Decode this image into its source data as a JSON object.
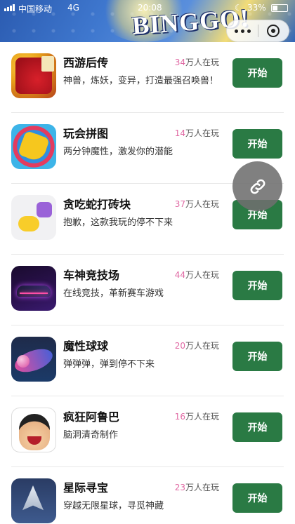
{
  "status_bar": {
    "carrier": "中国移动",
    "network": "4G",
    "time": "20:08",
    "battery_percent": "33%"
  },
  "header": {
    "banner_title": "BINGGO!",
    "menu_icon": "more-dots-icon",
    "close_icon": "target-close-icon"
  },
  "games": [
    {
      "name": "西游后传",
      "players_count": "34",
      "players_suffix": "万人在玩",
      "description": "神兽，炼妖，变异，打造最强召唤兽！",
      "start_label": "开始",
      "icon": "xiyou-game-icon"
    },
    {
      "name": "玩会拼图",
      "players_count": "14",
      "players_suffix": "万人在玩",
      "description": "两分钟魔性，激发你的潜能",
      "start_label": "开始",
      "icon": "jigsaw-game-icon"
    },
    {
      "name": "贪吃蛇打砖块",
      "players_count": "37",
      "players_suffix": "万人在玩",
      "description": "抱歉，这款我玩的停不下来",
      "start_label": "开始",
      "icon": "snake-game-icon"
    },
    {
      "name": "车神竞技场",
      "players_count": "44",
      "players_suffix": "万人在玩",
      "description": "在线竞技，革新赛车游戏",
      "start_label": "开始",
      "icon": "racing-car-game-icon"
    },
    {
      "name": "魔性球球",
      "players_count": "20",
      "players_suffix": "万人在玩",
      "description": "弹弹弹，弹到停不下来",
      "start_label": "开始",
      "icon": "ball-game-icon"
    },
    {
      "name": "疯狂阿鲁巴",
      "players_count": "16",
      "players_suffix": "万人在玩",
      "description": "脑洞清奇制作",
      "start_label": "开始",
      "icon": "aruba-game-icon"
    },
    {
      "name": "星际寻宝",
      "players_count": "23",
      "players_suffix": "万人在玩",
      "description": "穿越无限星球，寻觅神藏",
      "start_label": "开始",
      "icon": "space-treasure-game-icon"
    }
  ],
  "floating_button": {
    "icon": "link-icon"
  },
  "colors": {
    "start_button": "#2a7a44",
    "player_count": "#e06aa4"
  }
}
